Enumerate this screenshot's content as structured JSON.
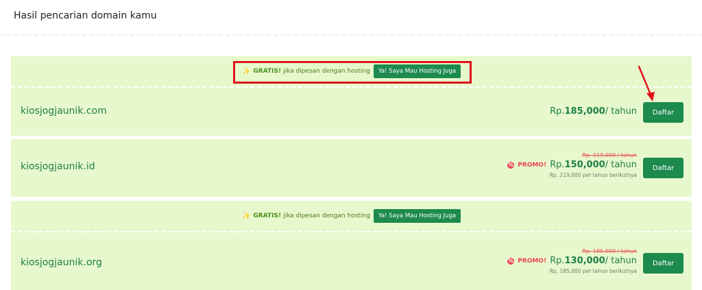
{
  "header": {
    "title": "Hasil pencarian domain kamu"
  },
  "promo": {
    "gratis_label": "GRATIS!",
    "text": "jika dipesan dengan hosting",
    "button_label": "Ya! Saya Mau Hosting Juga"
  },
  "results": [
    {
      "domain": "kiosjogjaunik.com",
      "currency": "Rp.",
      "price": "185,000",
      "period": "/ tahun",
      "button_label": "Daftar"
    },
    {
      "domain": "kiosjogjaunik.id",
      "old_price": "Rp. 219,000 / tahun",
      "promo_label": "PROMO!",
      "currency": "Rp.",
      "price": "150,000",
      "period": "/ tahun",
      "renewal": "Rp. 219,000 per tahun berikutnya",
      "button_label": "Daftar"
    },
    {
      "domain": "kiosjogjaunik.org",
      "old_price": "Rp. 185,000 / tahun",
      "promo_label": "PROMO!",
      "currency": "Rp.",
      "price": "130,000",
      "period": "/ tahun",
      "renewal": "Rp. 185,000 per tahun berikutnya",
      "button_label": "Daftar"
    }
  ],
  "colors": {
    "accent": "#1d8a4e",
    "card_bg": "#e8f8cd",
    "promo_red": "#e8454d",
    "highlight_red": "#e0141c"
  },
  "icons": {
    "sparkle": "sparkle-icon",
    "promo": "promo-percent-icon",
    "annotation_arrow": "arrow-icon"
  }
}
